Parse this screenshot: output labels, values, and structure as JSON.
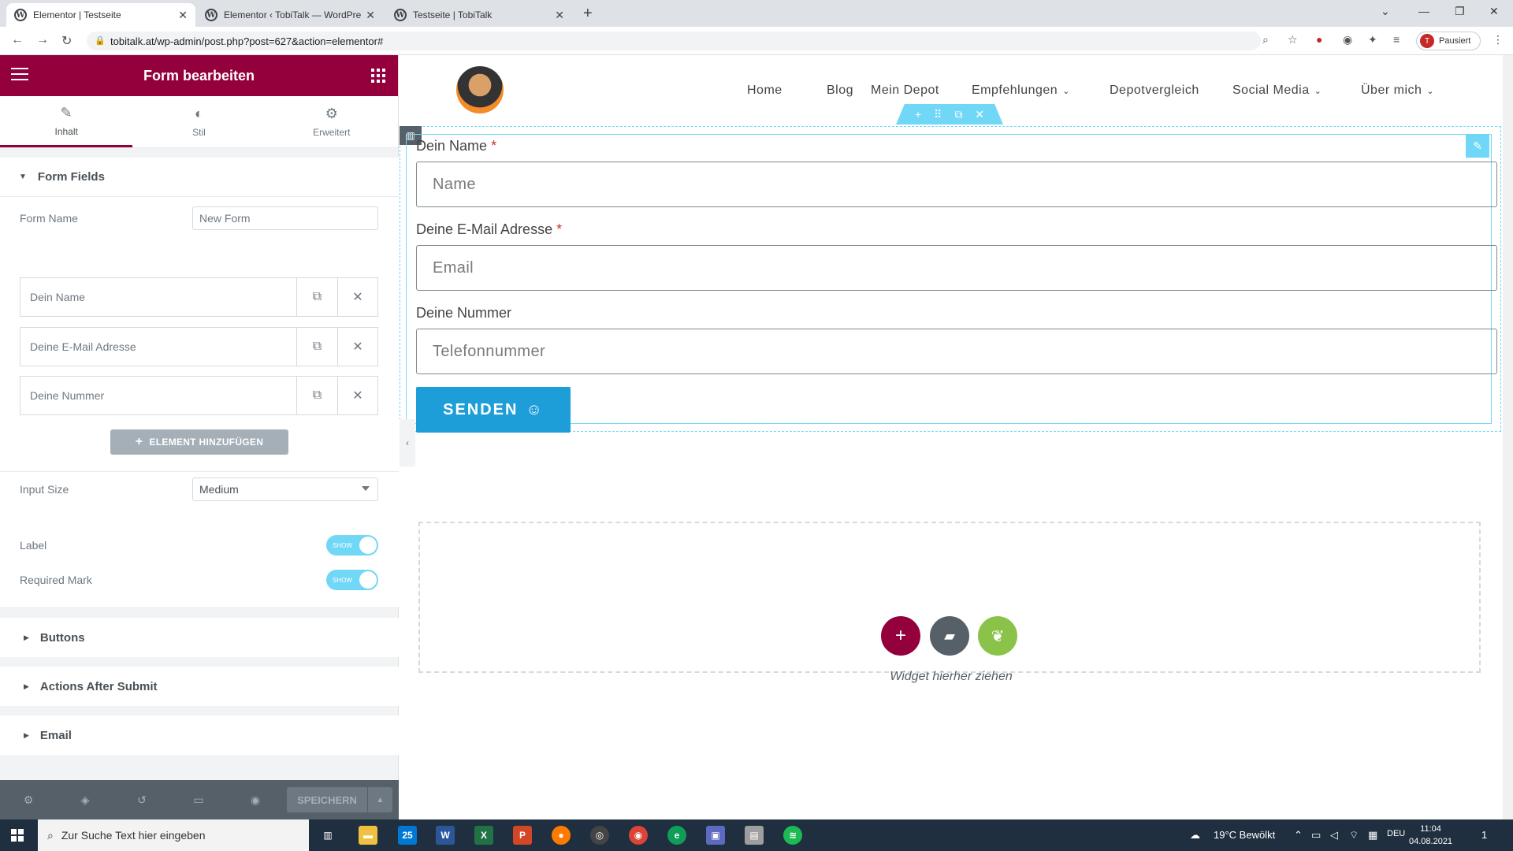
{
  "browser": {
    "tabs": [
      {
        "label": "Elementor | Testseite",
        "active": true
      },
      {
        "label": "Elementor ‹ TobiTalk — WordPre",
        "active": false
      },
      {
        "label": "Testseite | TobiTalk",
        "active": false
      }
    ],
    "url": "tobitalk.at/wp-admin/post.php?post=627&action=elementor#",
    "profile_label": "Pausiert",
    "profile_initial": "T"
  },
  "panel": {
    "title": "Form bearbeiten",
    "tabs": [
      {
        "label": "Inhalt",
        "icon": "pencil-icon",
        "glyph": "✎"
      },
      {
        "label": "Stil",
        "icon": "half-circle-icon",
        "glyph": "◐"
      },
      {
        "label": "Erweitert",
        "icon": "gear-icon",
        "glyph": "⚙"
      }
    ],
    "form_fields": {
      "section_title": "Form Fields",
      "form_name_label": "Form Name",
      "form_name_value": "New Form",
      "items": [
        "Dein Name",
        "Deine E-Mail Adresse",
        "Deine Nummer"
      ],
      "add_button": "ELEMENT HINZUFÜGEN",
      "input_size_label": "Input Size",
      "input_size_value": "Medium",
      "label_toggle_label": "Label",
      "label_toggle_value": "SHOW",
      "required_mark_label": "Required Mark",
      "required_mark_value": "SHOW"
    },
    "collapsed_sections": [
      "Buttons",
      "Actions After Submit",
      "Email"
    ],
    "footer": {
      "save_label": "SPEICHERN"
    }
  },
  "preview": {
    "nav": [
      {
        "label": "Home",
        "dropdown": false
      },
      {
        "label": "Blog",
        "dropdown": false
      },
      {
        "label": "Mein Depot",
        "dropdown": false
      },
      {
        "label": "Empfehlungen",
        "dropdown": true
      },
      {
        "label": "Depotvergleich",
        "dropdown": false
      },
      {
        "label": "Social Media",
        "dropdown": true
      },
      {
        "label": "Über mich",
        "dropdown": true
      }
    ],
    "form": {
      "name_label": "Dein Name",
      "name_placeholder": "Name",
      "email_label": "Deine E-Mail Adresse",
      "email_placeholder": "Email",
      "phone_label": "Deine Nummer",
      "phone_placeholder": "Telefonnummer",
      "required_mark": "*",
      "submit_label": "SENDEN"
    },
    "drop_hint": "Widget hierher ziehen"
  },
  "taskbar": {
    "search_placeholder": "Zur Suche Text hier eingeben",
    "mail_badge": "25",
    "weather": "19°C  Bewölkt",
    "language": "DEU",
    "time": "11:04",
    "date": "04.08.2021",
    "notification_count": "1"
  },
  "colors": {
    "elementor_brand": "#93003c",
    "editor_accent": "#71d7f7",
    "submit_button": "#1e9ed9",
    "template_button": "#8bc34a"
  }
}
